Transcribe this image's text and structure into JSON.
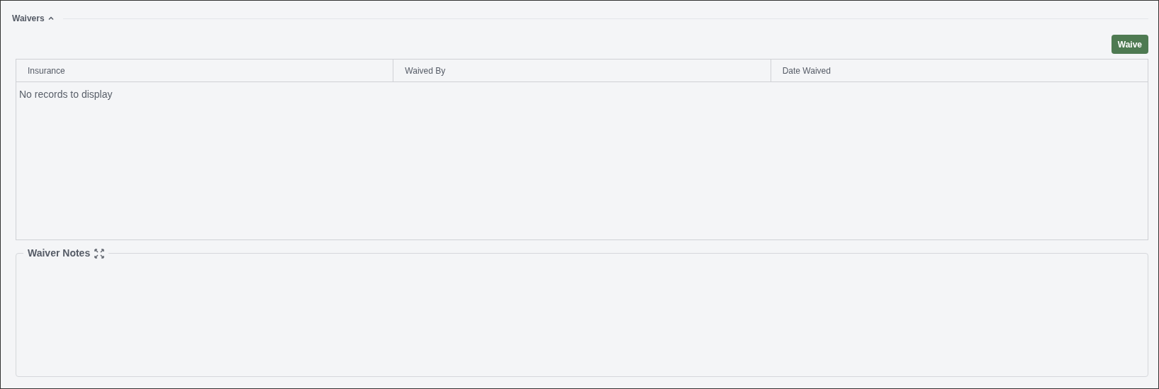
{
  "section": {
    "title": "Waivers",
    "expanded": true
  },
  "waive_button": "Waive",
  "table": {
    "columns": [
      "Insurance",
      "Waived By",
      "Date Waived"
    ],
    "empty_message": "No records to display"
  },
  "notes": {
    "title": "Waiver Notes"
  }
}
